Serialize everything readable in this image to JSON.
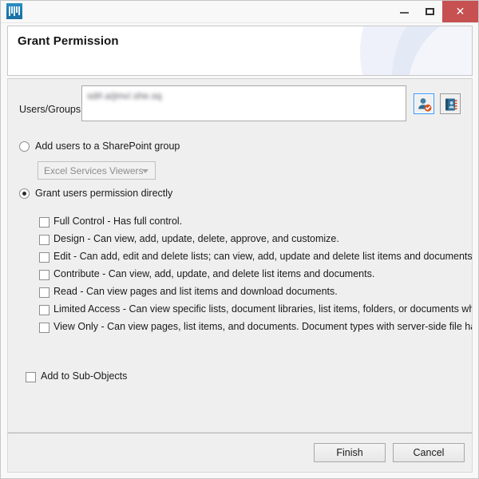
{
  "window": {
    "app_icon": "app-icon",
    "controls": {
      "minimize": "minimize-icon",
      "maximize": "maximize-icon",
      "close": "✕"
    }
  },
  "header": {
    "title": "Grant Permission"
  },
  "form": {
    "users_label": "Users/Groups:",
    "users_value": "sd#.a/jmv/.she.sq",
    "check_names_icon": "check-names-icon",
    "browse_icon": "address-book-icon",
    "radio_group_label": "Add users to a SharePoint group",
    "radio_group_selected": false,
    "group_select_value": "Excel Services Viewers",
    "group_select_enabled": false,
    "radio_direct_label": "Grant users permission directly",
    "radio_direct_selected": true,
    "permissions": [
      {
        "label": "Full Control - Has full control.",
        "checked": false
      },
      {
        "label": "Design - Can view, add, update, delete, approve, and customize.",
        "checked": false
      },
      {
        "label": "Edit - Can add, edit and delete lists; can view, add, update and delete list items and documents.",
        "checked": false
      },
      {
        "label": "Contribute - Can view, add, update, and delete list items and documents.",
        "checked": false
      },
      {
        "label": "Read - Can view pages and list items and download documents.",
        "checked": false
      },
      {
        "label": "Limited Access - Can view specific lists, document libraries, list items, folders, or documents when g",
        "checked": false
      },
      {
        "label": "View Only - Can view pages, list items, and documents. Document types with server-side file handle",
        "checked": false
      }
    ],
    "sub_objects_label": "Add to Sub-Objects",
    "sub_objects_checked": false
  },
  "buttons": {
    "finish": "Finish",
    "cancel": "Cancel"
  },
  "colors": {
    "close_button": "#c75050",
    "focus_border": "#3399ff",
    "panel_background": "#efefef",
    "header_background": "#ffffff"
  }
}
